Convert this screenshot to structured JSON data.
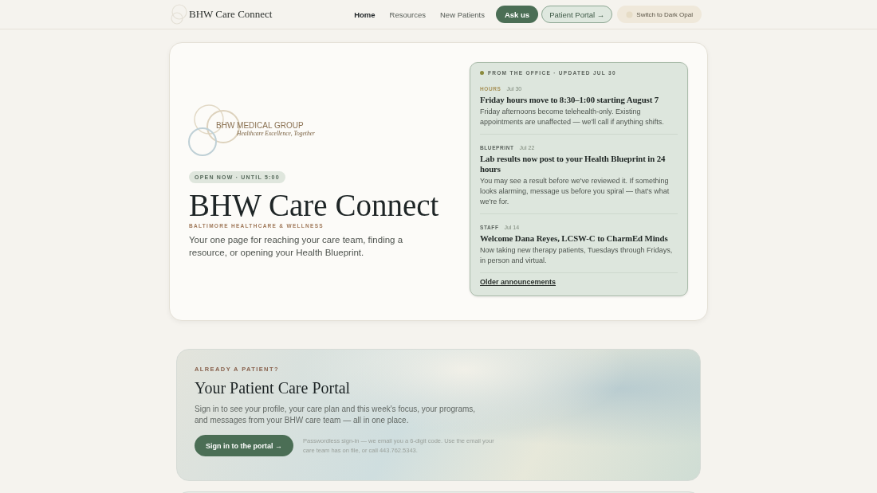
{
  "header": {
    "brand": "BHW Care Connect",
    "nav": [
      {
        "label": "Home",
        "selected": true
      },
      {
        "label": "Resources",
        "selected": false
      },
      {
        "label": "New Patients",
        "selected": false
      }
    ],
    "buttons": [
      {
        "label": "Ask us",
        "kind": "primary"
      },
      {
        "label": "Patient Portal →",
        "kind": "outline"
      },
      {
        "label": "Switch to Dark Opal",
        "kind": "theme"
      }
    ]
  },
  "hero": {
    "logo": {
      "name": "BHW MEDICAL GROUP",
      "tagline": "Healthcare Excellence, Together"
    },
    "status_badge": "OPEN NOW · UNTIL 5:00",
    "title": "BHW Care Connect",
    "subtitle": "BALTIMORE HEALTHCARE & WELLNESS",
    "description": "Your one page for reaching your care team, finding a resource, or opening your Health Blueprint.",
    "announcements": {
      "heading": "FROM THE OFFICE · UPDATED JUL 30",
      "items": [
        {
          "tag": "HOURS",
          "date": "Jul 30",
          "color": "#a8935a",
          "title": "Friday hours move to 8:30–1:00 starting August 7",
          "body": "Friday afternoons become telehealth-only. Existing appointments are unaffected — we'll call if anything shifts."
        },
        {
          "tag": "BLUEPRINT",
          "date": "Jul 22",
          "color": "#5e6660",
          "title": "Lab results now post to your Health Blueprint in 24 hours",
          "body": "You may see a result before we've reviewed it. If something looks alarming, message us before you spiral — that's what we're for."
        },
        {
          "tag": "STAFF",
          "date": "Jul 14",
          "color": "#5e6660",
          "title": "Welcome Dana Reyes, LCSW-C to CharmEd Minds",
          "body": "Now taking new therapy patients, Tuesdays through Fridays, in person and virtual."
        }
      ],
      "link": "Older announcements"
    }
  },
  "portal": {
    "eyebrow": "ALREADY A PATIENT?",
    "title": "Your Patient Care Portal",
    "description": "Sign in to see your profile, your care plan and this week's focus, your programs, and messages from your BHW care team — all in one place.",
    "button": "Sign in to the portal →",
    "note": "Passwordless sign-in — we email you a 6-digit code. Use the email your care team has on file, or call 443.762.5343."
  }
}
